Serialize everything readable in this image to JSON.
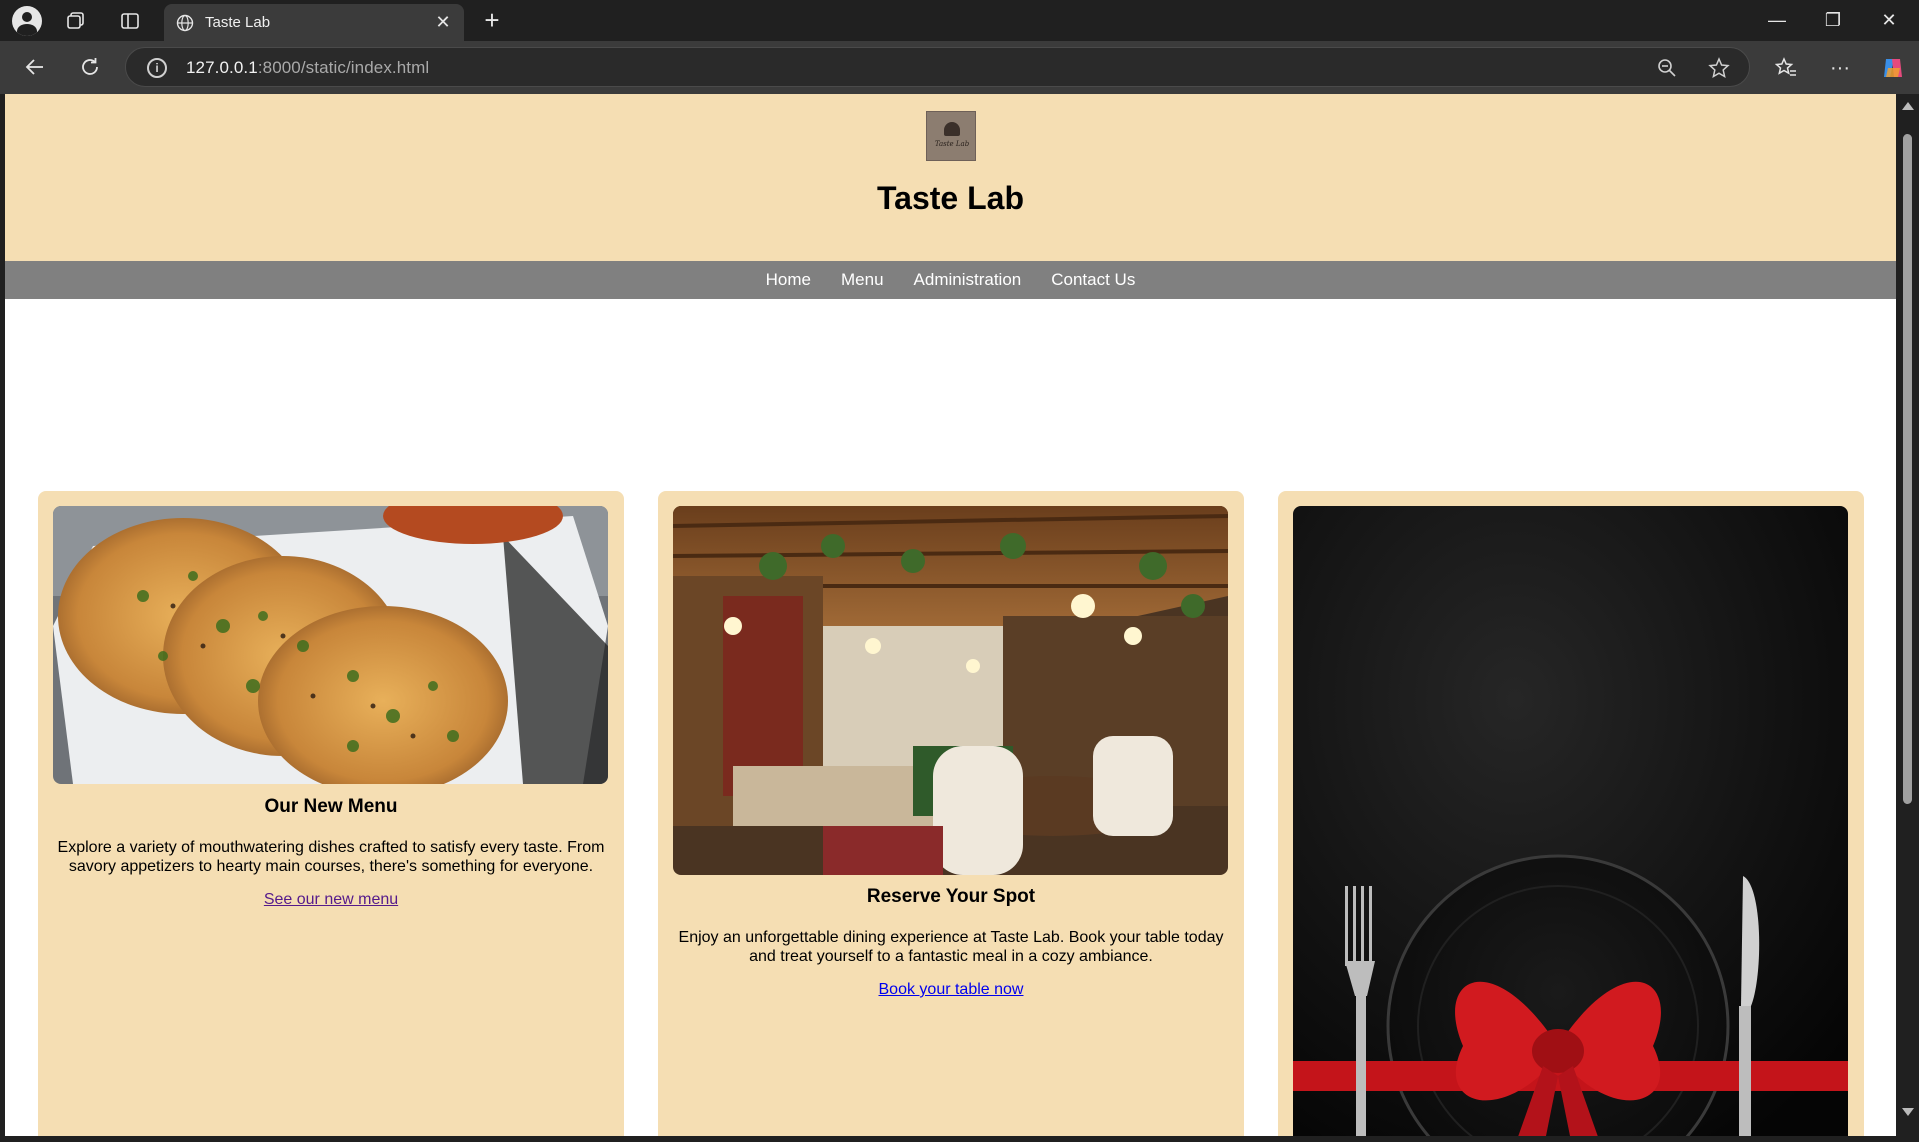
{
  "browser": {
    "tab_title": "Taste Lab",
    "url_host": "127.0.0.1",
    "url_path": ":8000/static/index.html"
  },
  "site": {
    "title": "Taste Lab",
    "logo_text": "Taste Lab"
  },
  "nav": {
    "items": [
      "Home",
      "Menu",
      "Administration",
      "Contact Us"
    ]
  },
  "cards": [
    {
      "heading": "Our New Menu",
      "body": "Explore a variety of mouthwatering dishes crafted to satisfy every taste. From savory appetizers to hearty main courses, there's something for everyone.",
      "link": "See our new menu",
      "link_color": "#551a8b"
    },
    {
      "heading": "Reserve Your Spot",
      "body": "Enjoy an unforgettable dining experience at Taste Lab. Book your table today and treat yourself to a fantastic meal in a cozy ambiance.",
      "link": "Book your table now",
      "link_color": "#0000ee"
    },
    {
      "heading": "",
      "body": "",
      "link": ""
    }
  ],
  "colors": {
    "header_bg": "#f5deb3",
    "nav_bg": "#808080",
    "card_bg": "#f5deb3"
  }
}
